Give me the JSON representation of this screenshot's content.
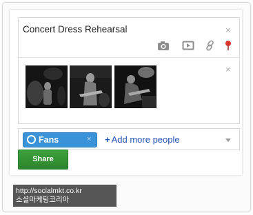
{
  "post": {
    "title": "Concert Dress Rehearsal",
    "close_glyph": "×",
    "tools": [
      "camera-icon",
      "video-icon",
      "link-icon",
      "location-pin-icon"
    ]
  },
  "media": {
    "close_glyph": "×",
    "photos": [
      "concert photo 1",
      "concert photo 2",
      "concert photo 3"
    ]
  },
  "audience": {
    "chip_label": "Fans",
    "chip_remove": "×",
    "add_more": "Add more people",
    "add_more_plus": "+"
  },
  "share_button": "Share",
  "watermark": {
    "line1": "http://socialmkt.co.kr",
    "line2": "소셜마케팅코리아"
  },
  "colors": {
    "chip": "#3a93d8",
    "share": "#2f8c2f",
    "link": "#2552b5",
    "pin": "#d9372d"
  }
}
